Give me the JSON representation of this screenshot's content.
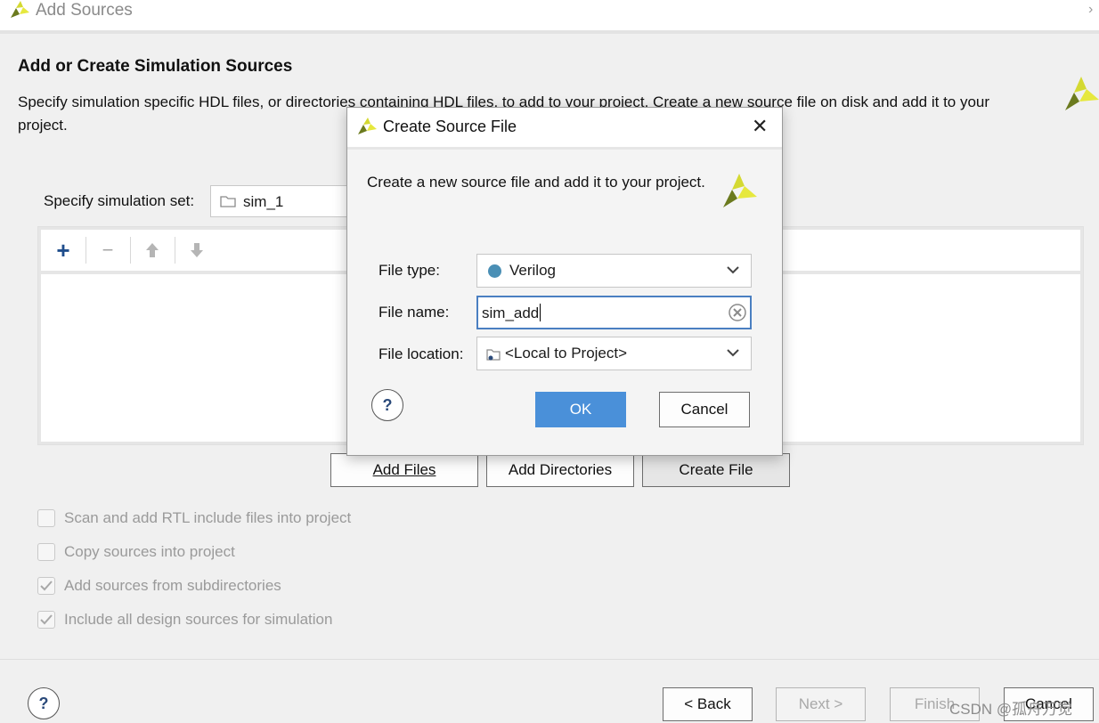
{
  "window": {
    "title": "Add Sources"
  },
  "page": {
    "heading": "Add or Create Simulation Sources",
    "description": "Specify simulation specific HDL files, or directories containing HDL files, to add to your project. Create a new source file on disk and add it to your project."
  },
  "simset": {
    "label": "Specify simulation set:",
    "value": "sim_1"
  },
  "toolbar": {
    "add_icon": "plus-icon",
    "remove_icon": "minus-icon",
    "up_icon": "arrow-up-icon",
    "down_icon": "arrow-down-icon"
  },
  "source_buttons": {
    "add_files": "Add Files",
    "add_directories": "Add Directories",
    "create_file": "Create File"
  },
  "options": [
    {
      "label": "Scan and add RTL include files into project",
      "checked": false
    },
    {
      "label": "Copy sources into project",
      "checked": false
    },
    {
      "label": "Add sources from subdirectories",
      "checked": true
    },
    {
      "label": "Include all design sources for simulation",
      "checked": true
    }
  ],
  "footer": {
    "help": "?",
    "back": "< Back",
    "next": "Next >",
    "finish": "Finish",
    "cancel": "Cancel"
  },
  "watermark": "CSDN @孤舟万觉",
  "dialog": {
    "title": "Create Source File",
    "description": "Create a new source file and add it to your project.",
    "file_type_label": "File type:",
    "file_type_value": "Verilog",
    "file_name_label": "File name:",
    "file_name_value": "sim_add",
    "file_location_label": "File location:",
    "file_location_value": "<Local to Project>",
    "help": "?",
    "ok": "OK",
    "cancel": "Cancel"
  },
  "colors": {
    "accent": "#4a90d9",
    "logo_yellow": "#d4d932",
    "logo_green": "#6b7a1e",
    "verilog_dot": "#4a8fb5"
  }
}
